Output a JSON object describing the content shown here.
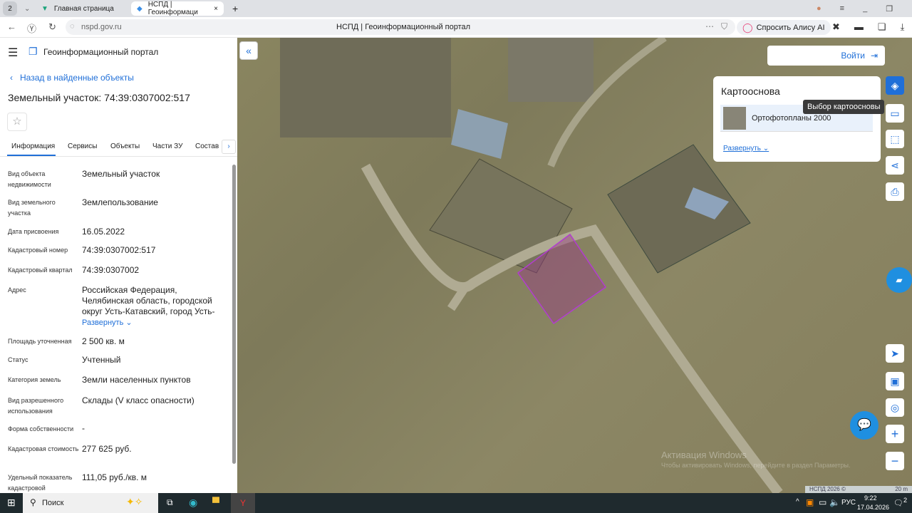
{
  "browser": {
    "tab_count": "2",
    "tabs": [
      {
        "label": "Главная страница"
      },
      {
        "label": "НСПД | Геоинформаци"
      }
    ],
    "url": "nspd.gov.ru",
    "page_title": "НСПД | Геоинформационный портал",
    "alice": "Спросить Алису AI"
  },
  "header": {
    "title": "Геоинформационный портал"
  },
  "panel": {
    "back": "Назад в найденные объекты",
    "title": "Земельный участок: 74:39:0307002:517",
    "tabs": [
      "Информация",
      "Сервисы",
      "Объекты",
      "Части ЗУ",
      "Состав"
    ],
    "rows": [
      {
        "label": "Вид объекта недвижимости",
        "value": "Земельный участок"
      },
      {
        "label": "Вид земельного участка",
        "value": "Землепользование"
      },
      {
        "label": "Дата присвоения",
        "value": "16.05.2022"
      },
      {
        "label": "Кадастровый номер",
        "value": "74:39:0307002:517"
      },
      {
        "label": "Кадастровый квартал",
        "value": "74:39:0307002"
      },
      {
        "label": "Адрес",
        "value": "Российская Федерация, Челябинская область, городской округ Усть-Катавский, город Усть-"
      },
      {
        "label": "Площадь уточненная",
        "value": "2 500 кв. м"
      },
      {
        "label": "Статус",
        "value": "Учтенный"
      },
      {
        "label": "Категория земель",
        "value": "Земли населенных пунктов"
      },
      {
        "label": "Вид разрешенного использования",
        "value": "Склады (V класс опасности)"
      },
      {
        "label": "Форма собственности",
        "value": "-"
      },
      {
        "label": "Кадастровая стоимость",
        "value": "277 625 руб."
      },
      {
        "label": "Удельный показатель кадастровой",
        "value": "111,05 руб./кв. м"
      }
    ],
    "expand": "Развернуть"
  },
  "map": {
    "login": "Войти",
    "basemap_title": "Картооснова",
    "basemap_item": "Ортофотопланы 2000",
    "basemap_expand": "Развернуть",
    "tooltip": "Выбор картоосновы",
    "copyright": "НСПД 2026 ©",
    "scale": "20 m",
    "watermark1": "Активация Windows",
    "watermark2": "Чтобы активировать Windows, перейдите в раздел Параметры."
  },
  "taskbar": {
    "search": "Поиск",
    "lang": "РУС",
    "time": "9:22",
    "date": "17.04.2026",
    "notifications": "2"
  }
}
